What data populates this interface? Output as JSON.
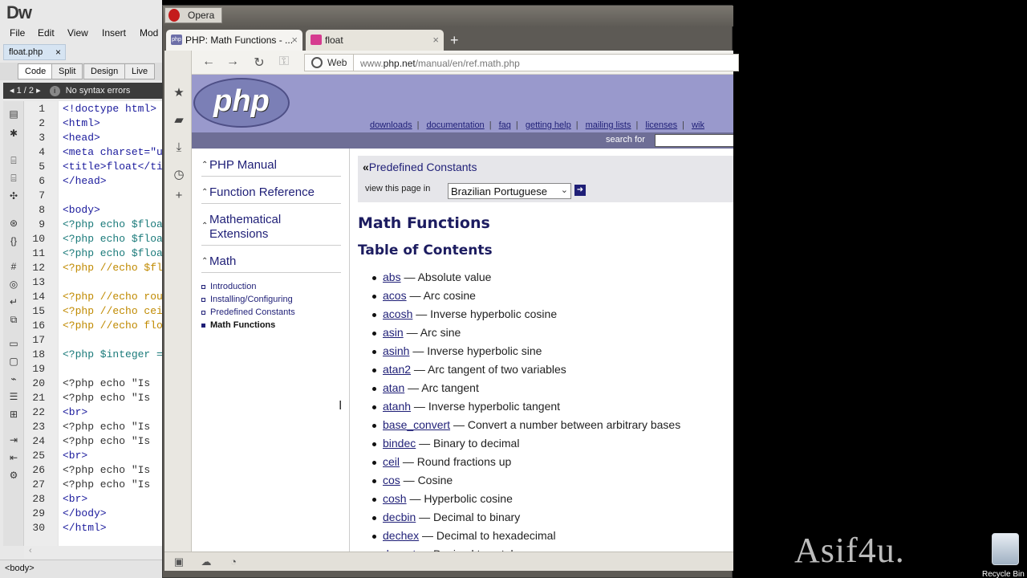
{
  "dreamweaver": {
    "logo": "Dw",
    "menu": [
      "File",
      "Edit",
      "View",
      "Insert",
      "Mod"
    ],
    "doc_tab": "float.php",
    "doc_tab_close": "×",
    "view_buttons": [
      "Code",
      "Split",
      "Design",
      "Live"
    ],
    "status_pages": "1 / 2",
    "status_info": "i",
    "status_text": "No syntax errors",
    "line_numbers": [
      "1",
      "2",
      "3",
      "4",
      "5",
      "6",
      "7",
      "8",
      "9",
      "10",
      "11",
      "12",
      "13",
      "14",
      "15",
      "16",
      "17",
      "18",
      "19",
      "20",
      "21",
      "22",
      "23",
      "24",
      "25",
      "26",
      "27",
      "28",
      "29",
      "30"
    ],
    "code_lines": [
      "<!doctype html>",
      "<html>",
      "<head>",
      "<meta charset=\"u",
      "<title>float</ti",
      "</head>",
      "",
      "<body>",
      "<?php echo $floa",
      "<?php echo $floa",
      "<?php echo $floa",
      "<?php //echo $fl",
      "",
      "<?php //echo rou",
      "<?php //echo cei",
      "<?php //echo flo",
      "",
      "<?php $integer =",
      "",
      "<?php echo \"Is",
      "<?php echo \"Is",
      "<br>",
      "<?php echo \"Is",
      "<?php echo \"Is",
      "<br>",
      "<?php echo \"Is",
      "<?php echo \"Is",
      "<br>",
      "</body>",
      "</html>"
    ],
    "tag_selector": "<body>"
  },
  "opera": {
    "title_button": "Opera",
    "tabs": [
      {
        "label": "PHP: Math Functions - ...",
        "favicon": "php",
        "close": "×"
      },
      {
        "label": "float",
        "favicon": "",
        "close": "×"
      }
    ],
    "new_tab": "+",
    "web_button": "Web",
    "url_prefix": "www.",
    "url_domain": "php.net",
    "url_path": "/manual/en/ref.math.php"
  },
  "php_page": {
    "logo": "php",
    "top_links": [
      "downloads",
      "documentation",
      "faq",
      "getting help",
      "mailing lists",
      "licenses",
      "wik"
    ],
    "search_label": "search for",
    "left_nav": [
      {
        "label": "PHP Manual"
      },
      {
        "label": "Function Reference"
      },
      {
        "label": "Mathematical Extensions"
      },
      {
        "label": "Math"
      }
    ],
    "sub_nav": [
      "Introduction",
      "Installing/Configuring",
      "Predefined Constants",
      "Math Functions"
    ],
    "breadcrumb_prefix": "«",
    "breadcrumb": "Predefined Constants",
    "view_page_in": "view this page in",
    "language": "Brazilian Portuguese",
    "title": "Math Functions",
    "toc_title": "Table of Contents",
    "functions": [
      {
        "name": "abs",
        "desc": " — Absolute value"
      },
      {
        "name": "acos",
        "desc": " — Arc cosine"
      },
      {
        "name": "acosh",
        "desc": " — Inverse hyperbolic cosine"
      },
      {
        "name": "asin",
        "desc": " — Arc sine"
      },
      {
        "name": "asinh",
        "desc": " — Inverse hyperbolic sine"
      },
      {
        "name": "atan2",
        "desc": " — Arc tangent of two variables"
      },
      {
        "name": "atan",
        "desc": " — Arc tangent"
      },
      {
        "name": "atanh",
        "desc": " — Inverse hyperbolic tangent"
      },
      {
        "name": "base_convert",
        "desc": " — Convert a number between arbitrary bases"
      },
      {
        "name": "bindec",
        "desc": " — Binary to decimal"
      },
      {
        "name": "ceil",
        "desc": " — Round fractions up"
      },
      {
        "name": "cos",
        "desc": " — Cosine"
      },
      {
        "name": "cosh",
        "desc": " — Hyperbolic cosine"
      },
      {
        "name": "decbin",
        "desc": " — Decimal to binary"
      },
      {
        "name": "dechex",
        "desc": " — Decimal to hexadecimal"
      },
      {
        "name": "decoct",
        "desc": " — Decimal to octal"
      }
    ]
  },
  "desktop": {
    "watermark": "Asif4u.",
    "recycle_bin": "Recycle Bin"
  }
}
